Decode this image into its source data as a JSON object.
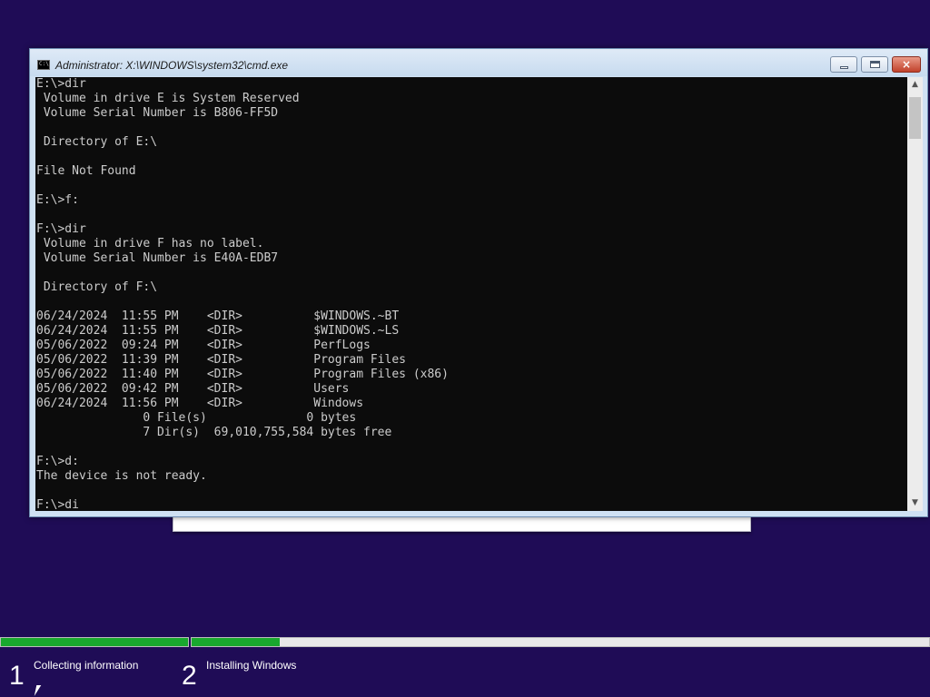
{
  "window": {
    "title": "Administrator: X:\\WINDOWS\\system32\\cmd.exe",
    "icon_label": "C:\\",
    "buttons": {
      "minimize": "minimize-icon",
      "maximize": "maximize-icon",
      "close": "×"
    }
  },
  "console": {
    "lines": [
      "E:\\>dir",
      " Volume in drive E is System Reserved",
      " Volume Serial Number is B806-FF5D",
      "",
      " Directory of E:\\",
      "",
      "File Not Found",
      "",
      "E:\\>f:",
      "",
      "F:\\>dir",
      " Volume in drive F has no label.",
      " Volume Serial Number is E40A-EDB7",
      "",
      " Directory of F:\\",
      "",
      "06/24/2024  11:55 PM    <DIR>          $WINDOWS.~BT",
      "06/24/2024  11:55 PM    <DIR>          $WINDOWS.~LS",
      "05/06/2022  09:24 PM    <DIR>          PerfLogs",
      "05/06/2022  11:39 PM    <DIR>          Program Files",
      "05/06/2022  11:40 PM    <DIR>          Program Files (x86)",
      "05/06/2022  09:42 PM    <DIR>          Users",
      "06/24/2024  11:56 PM    <DIR>          Windows",
      "               0 File(s)              0 bytes",
      "               7 Dir(s)  69,010,755,584 bytes free",
      "",
      "F:\\>d:",
      "The device is not ready.",
      "",
      "F:\\>di"
    ]
  },
  "scrollbar": {
    "up": "▲",
    "down": "▼"
  },
  "setup": {
    "progress": [
      {
        "step": "1",
        "fraction_complete": 1.0
      },
      {
        "step": "2",
        "fraction_complete": 0.12
      }
    ],
    "steps": [
      {
        "number": "1",
        "label": "Collecting information"
      },
      {
        "number": "2",
        "label": "Installing Windows"
      }
    ]
  },
  "colors": {
    "background": "#1f0c56",
    "progress_fill": "#19a82e",
    "console_bg": "#0c0c0c",
    "console_text": "#cccccc"
  }
}
